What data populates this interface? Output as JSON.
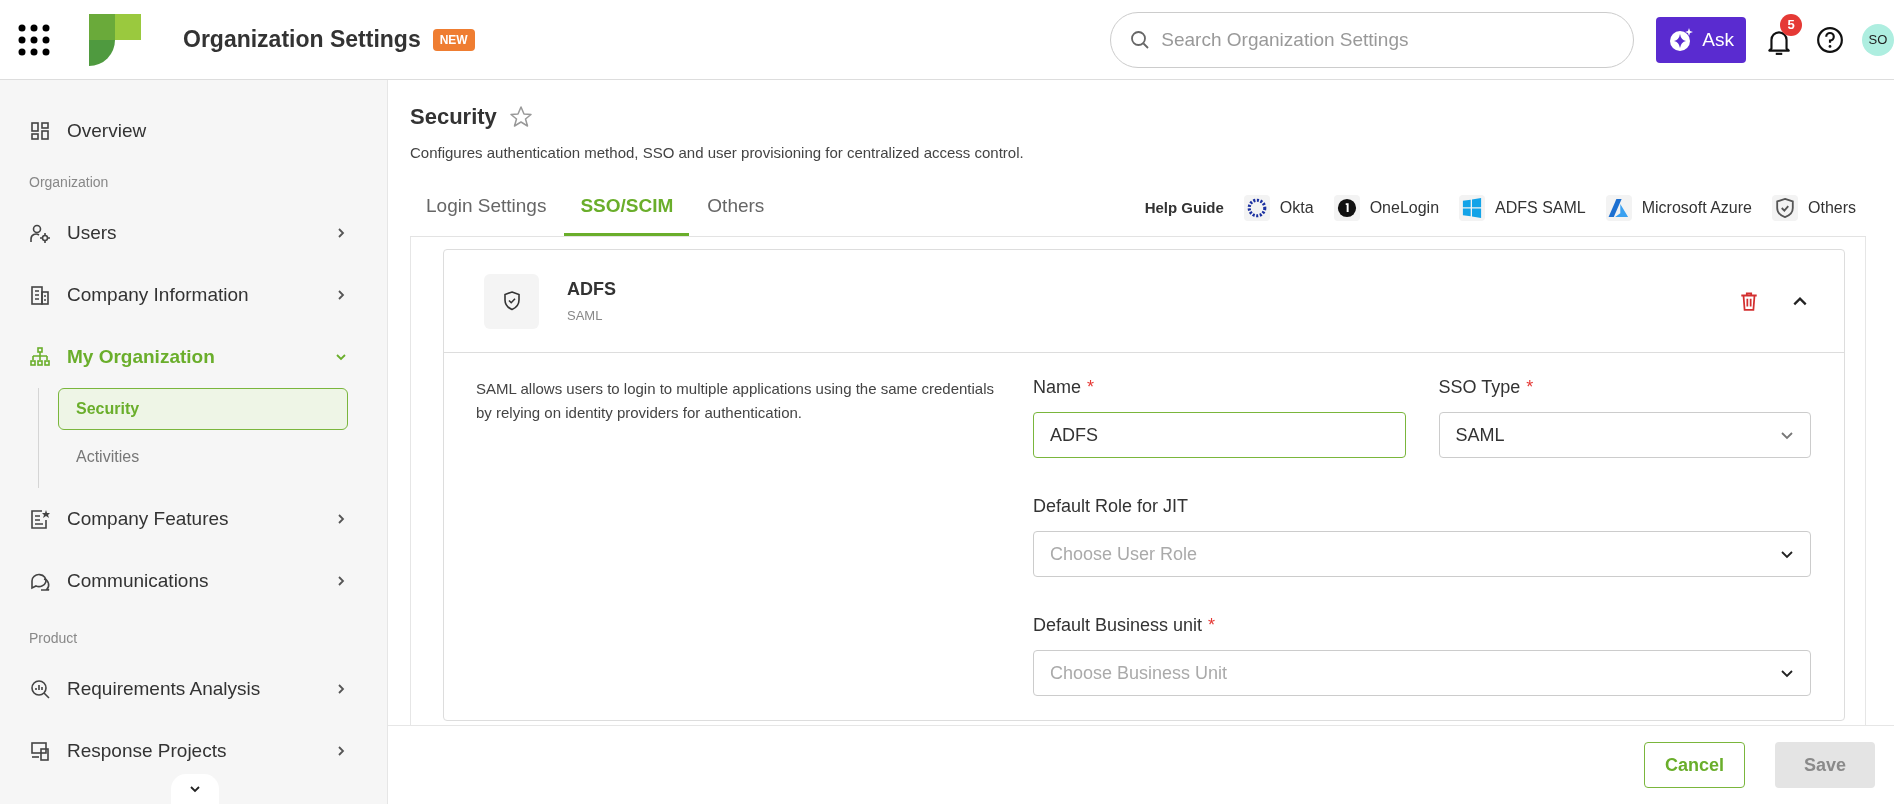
{
  "header": {
    "title": "Organization Settings",
    "badge": "NEW",
    "search": {
      "placeholder": "Search Organization Settings"
    },
    "ask_button": "Ask",
    "notifications": "5",
    "avatar": "SO"
  },
  "sidebar": {
    "items": [
      {
        "kind": "item",
        "label": "Overview",
        "selected": false
      },
      {
        "kind": "section",
        "label": "Organization"
      },
      {
        "kind": "item",
        "label": "Users",
        "selected": false,
        "expanded": false
      },
      {
        "kind": "item",
        "label": "Company Information",
        "selected": false,
        "expanded": false
      },
      {
        "kind": "item",
        "label": "My Organization",
        "selected": true,
        "expanded": true,
        "children": [
          {
            "label": "Security",
            "selected": true
          },
          {
            "label": "Activities",
            "selected": false
          }
        ]
      },
      {
        "kind": "item",
        "label": "Company Features",
        "selected": false,
        "expanded": false
      },
      {
        "kind": "item",
        "label": "Communications",
        "selected": false,
        "expanded": false
      },
      {
        "kind": "section",
        "label": "Product"
      },
      {
        "kind": "item",
        "label": "Requirements Analysis",
        "selected": false,
        "expanded": false
      },
      {
        "kind": "item",
        "label": "Response Projects",
        "selected": false,
        "expanded": false
      }
    ]
  },
  "page": {
    "title": "Security",
    "favorite": false,
    "description": "Configures authentication method, SSO and user provisioning for centralized access control.",
    "tabs": [
      {
        "label": "Login Settings",
        "selected": false
      },
      {
        "label": "SSO/SCIM",
        "selected": true
      },
      {
        "label": "Others",
        "selected": false
      }
    ],
    "help_guide": {
      "label": "Help Guide",
      "links": [
        "Okta",
        "OneLogin",
        "ADFS SAML",
        "Microsoft Azure",
        "Others"
      ]
    }
  },
  "sso_card": {
    "title": "ADFS",
    "subtitle": "SAML",
    "expanded": true,
    "description": "SAML allows users to login to multiple applications using the same credentials by relying on identity providers for authentication.",
    "field_rows": [
      [
        {
          "kind": "text",
          "label": "Name",
          "required_mark": "*",
          "value": "ADFS",
          "focused": true
        },
        {
          "kind": "select",
          "label": "SSO Type",
          "required_mark": "*",
          "value": "SAML"
        }
      ],
      [
        {
          "kind": "select",
          "label": "Default Role for JIT",
          "placeholder": "Choose User Role"
        }
      ],
      [
        {
          "kind": "select",
          "label": "Default Business unit",
          "required_mark": "*",
          "placeholder": "Choose Business Unit"
        }
      ]
    ]
  },
  "footer": {
    "buttons": [
      {
        "label": "Cancel",
        "disabled": false
      },
      {
        "label": "Save",
        "disabled": true
      }
    ]
  }
}
